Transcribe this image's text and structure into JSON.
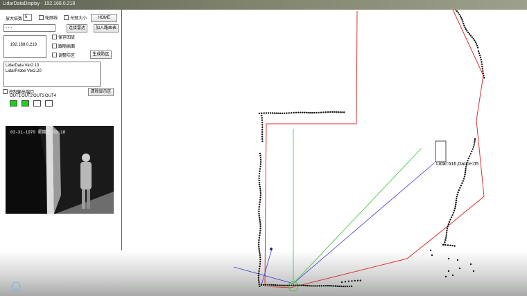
{
  "window": {
    "title": "LidarDataDisplay - 192.168.0.218"
  },
  "controls": {
    "zoom_label": "放大倍数",
    "zoom_value": "5",
    "checkbox_a": "轮廓线",
    "checkbox_b": "光斑大小",
    "home_button": "HOME",
    "ip_address_value": "  -    -    -  ",
    "connect_button": "连接雷达",
    "import_button": "加入路由表",
    "device_list_item": "192.168.0.218",
    "option_1": "保存回放",
    "option_2": "跟随画面",
    "option_3": "调整防区",
    "set_zone_button": "生成防区",
    "version_lines": [
      "LidarData Ver2.10",
      "LidarProbe Ver2.20"
    ],
    "control_output_label": "控制输出端口",
    "clear_zone_button": "清除显示区",
    "outputs": [
      {
        "label": "OUT1",
        "state": "on"
      },
      {
        "label": "OUT2",
        "state": "on"
      },
      {
        "label": "OUT3",
        "state": "off"
      },
      {
        "label": "OUT4",
        "state": "off"
      }
    ]
  },
  "camera": {
    "timestamp": "03-31-1970  星期二  03:18"
  },
  "plot": {
    "target_label": "Lidar:616,Dance:05"
  },
  "colors": {
    "zone_outline": "#e03030",
    "scan_points": "#111111",
    "beam_blue": "#3b3bd6",
    "beam_green": "#2fc42f",
    "indicator_on": "#22cc22"
  }
}
